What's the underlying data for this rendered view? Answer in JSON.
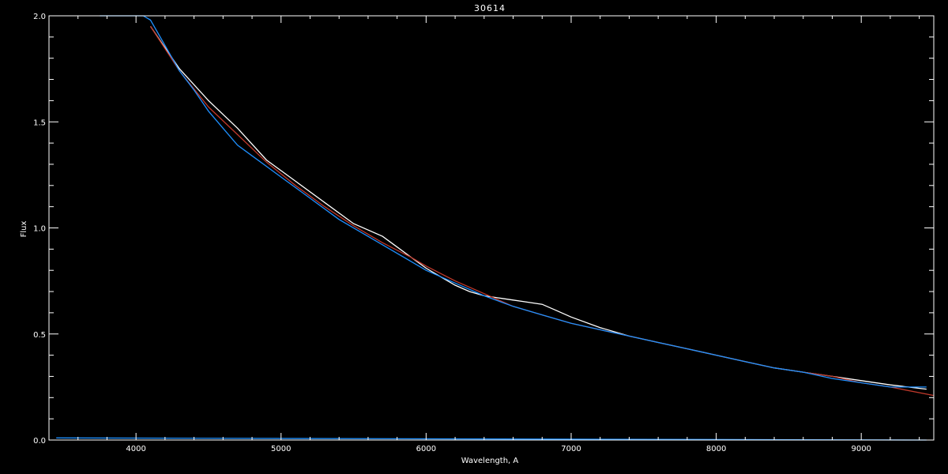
{
  "chart_data": {
    "type": "line",
    "title": "30614",
    "xlabel": "Wavelength, A",
    "ylabel": "Flux",
    "xlim": [
      3400,
      9500
    ],
    "ylim": [
      0,
      2.0
    ],
    "x_ticks": [
      4000,
      5000,
      6000,
      7000,
      8000,
      9000
    ],
    "x_tick_labels": [
      "4000",
      "5000",
      "6000",
      "7000",
      "8000",
      "9000"
    ],
    "y_ticks": [
      0.0,
      0.5,
      1.0,
      1.5,
      2.0
    ],
    "y_tick_labels": [
      "0.0",
      "0.5",
      "1.0",
      "1.5",
      "2.0"
    ],
    "grid": false,
    "colors": {
      "background": "#000000",
      "axes": "#ffffff",
      "white_spectrum": "#ffffff",
      "model_fit": "#c0392b",
      "blue_spectrum": "#1e90ff"
    },
    "series": [
      {
        "color": "#ffffff",
        "x": [
          4100,
          4300,
          4500,
          4700,
          4900,
          5100,
          5300,
          5500,
          5700,
          5800,
          5900,
          6000,
          6100,
          6200,
          6300,
          6400,
          6500,
          6600,
          6700,
          6800,
          6900,
          7000,
          7200,
          7400,
          7600,
          7800,
          8000,
          8200,
          8400,
          8600,
          8800,
          9000,
          9200,
          9450
        ],
        "y": [
          1.95,
          1.75,
          1.6,
          1.47,
          1.32,
          1.22,
          1.12,
          1.02,
          0.96,
          0.91,
          0.86,
          0.81,
          0.77,
          0.73,
          0.7,
          0.68,
          0.67,
          0.66,
          0.65,
          0.64,
          0.61,
          0.58,
          0.53,
          0.49,
          0.46,
          0.43,
          0.4,
          0.37,
          0.34,
          0.32,
          0.3,
          0.28,
          0.26,
          0.24
        ]
      },
      {
        "color": "#c0392b",
        "x": [
          4100,
          4300,
          4500,
          4700,
          4900,
          5100,
          5300,
          5500,
          5700,
          5900,
          6000,
          6200,
          6400,
          6600,
          6800,
          7000,
          7200,
          7400,
          7600,
          7800,
          8000,
          8200,
          8400,
          8600,
          8800,
          9000,
          9200,
          9500
        ],
        "y": [
          1.95,
          1.74,
          1.57,
          1.44,
          1.31,
          1.2,
          1.1,
          1.01,
          0.93,
          0.86,
          0.82,
          0.75,
          0.69,
          0.63,
          0.59,
          0.55,
          0.52,
          0.49,
          0.46,
          0.43,
          0.4,
          0.37,
          0.34,
          0.32,
          0.3,
          0.27,
          0.25,
          0.21
        ]
      },
      {
        "color": "#1e90ff",
        "x": [
          3750,
          3900,
          4000,
          4050,
          4100,
          4200,
          4300,
          4400,
          4500,
          4600,
          4700,
          4800,
          4900,
          5000,
          5200,
          5400,
          5600,
          5800,
          6000,
          6200,
          6400,
          6600,
          6800,
          7000,
          7200,
          7400,
          7600,
          7800,
          8000,
          8200,
          8400,
          8600,
          8800,
          9000,
          9200,
          9450
        ],
        "y": [
          2.0,
          2.0,
          2.0,
          2.0,
          1.98,
          1.86,
          1.74,
          1.65,
          1.55,
          1.47,
          1.39,
          1.34,
          1.29,
          1.24,
          1.14,
          1.04,
          0.96,
          0.88,
          0.8,
          0.74,
          0.68,
          0.63,
          0.59,
          0.55,
          0.52,
          0.49,
          0.46,
          0.43,
          0.4,
          0.37,
          0.34,
          0.32,
          0.29,
          0.27,
          0.25,
          0.25
        ]
      },
      {
        "color": "#1e90ff",
        "x": [
          3450,
          9450
        ],
        "y": [
          0.01,
          0.0
        ]
      }
    ],
    "annotations": []
  }
}
